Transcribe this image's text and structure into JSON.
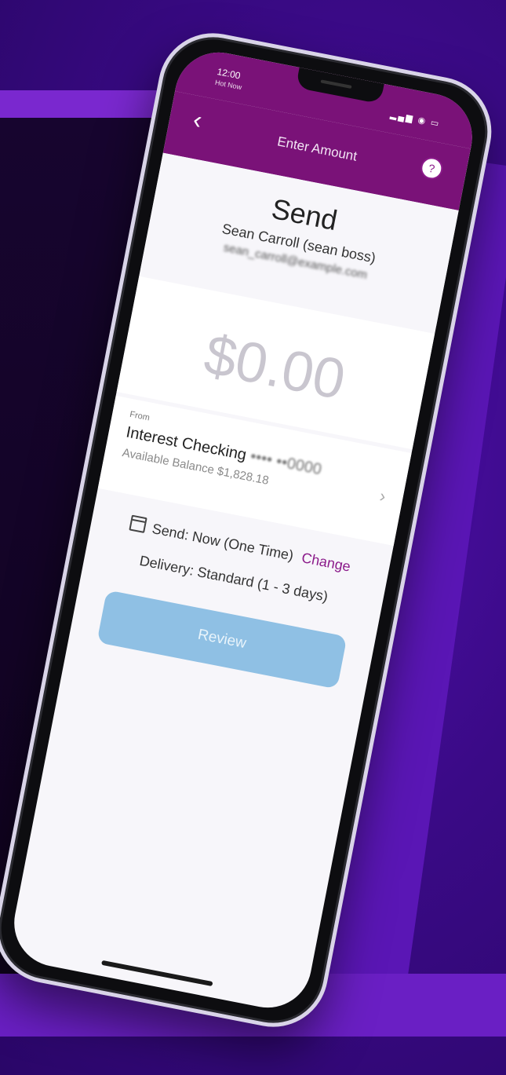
{
  "status_bar": {
    "time": "12:00",
    "carrier": "Hot Now",
    "icons": "▂▄▆ ◉ ▭"
  },
  "nav": {
    "back_icon": "‹",
    "title": "Enter Amount",
    "help_icon": "?"
  },
  "send": {
    "title": "Send",
    "recipient_name": "Sean Carroll (sean boss)",
    "recipient_email": "sean_carroll@example.com"
  },
  "amount": {
    "value": "$0.00"
  },
  "from": {
    "label": "From",
    "account_name": "Interest Checking",
    "account_mask": "•••• ••0000",
    "available_balance": "Available Balance $1,828.18"
  },
  "schedule": {
    "text": "Send: Now (One Time)",
    "change_label": "Change"
  },
  "delivery": {
    "text": "Delivery: Standard (1 - 3 days)"
  },
  "review_button": {
    "label": "Review"
  },
  "colors": {
    "brand": "#7a1278",
    "background": "#3a0a86",
    "button": "#8fc0e4"
  }
}
